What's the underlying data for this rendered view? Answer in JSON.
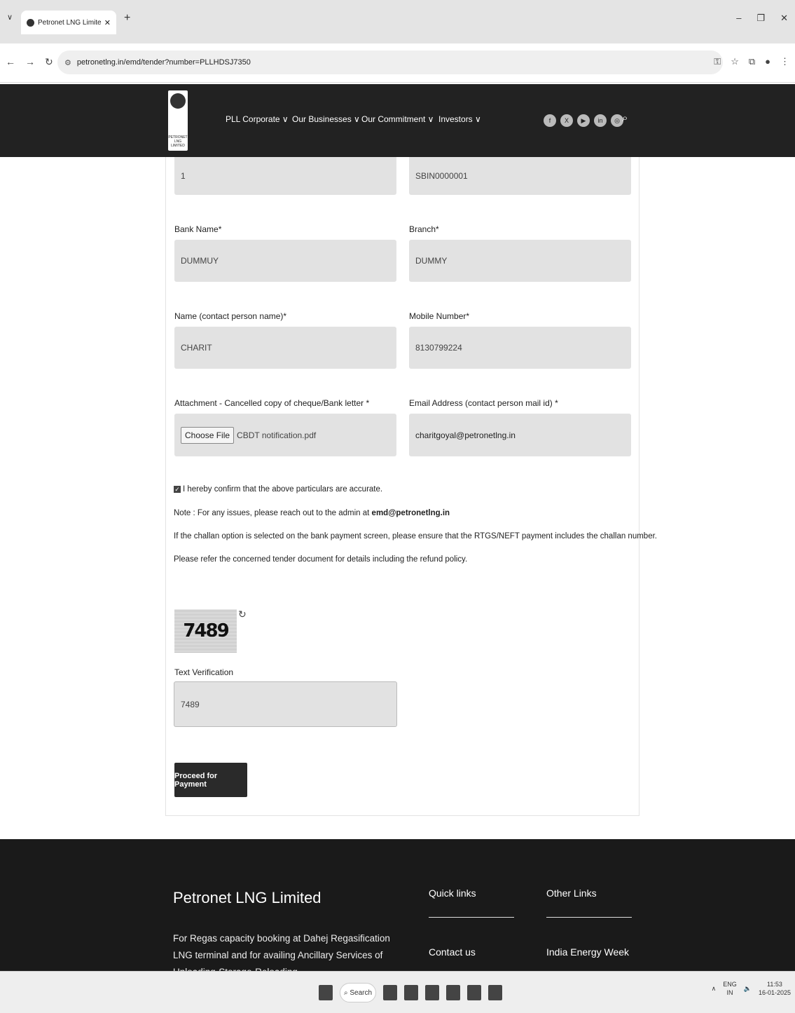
{
  "browser": {
    "tab_title": "Petronet LNG Limited : EMD/Te",
    "url": "petronetlng.in/emd/tender?number=PLLHDSJ7350"
  },
  "header": {
    "menu": [
      "PLL Corporate ∨",
      "Our Businesses ∨",
      "Our Commitment ∨",
      "Investors ∨"
    ],
    "socials": [
      "f",
      "X",
      "▶",
      "in",
      "◎"
    ],
    "logo_text": [
      "PETRONET",
      "LNG",
      "LIMITED"
    ]
  },
  "form": {
    "account_number": "1",
    "ifsc": "SBIN0000001",
    "bank_name_label": "Bank Name*",
    "bank_name": "DUMMUY",
    "branch_label": "Branch*",
    "branch": "DUMMY",
    "contact_label": "Name (contact person name)*",
    "contact": "CHARIT",
    "mobile_label": "Mobile Number*",
    "mobile": "8130799224",
    "attachment_label": "Attachment - Cancelled copy of cheque/Bank letter *",
    "choose_file": "Choose File",
    "file_name": "CBDT notification.pdf",
    "email_label": "Email Address (contact person mail id) *",
    "email": "charitgoyal@petronetlng.in",
    "confirm": "I hereby confirm that the above particulars are accurate.",
    "note_prefix": "Note : For any issues, please reach out to the admin at ",
    "note_email": "emd@petronetlng.in",
    "challan_note": "If the challan option is selected on the bank payment screen, please ensure that the RTGS/NEFT payment includes the challan number.",
    "refund_note": "Please refer the concerned tender document for details including the refund policy.",
    "captcha": "7489",
    "verification_label": "Text Verification",
    "verification_value": "7489",
    "proceed": "Proceed for Payment"
  },
  "footer": {
    "title": "Petronet LNG Limited",
    "desc": "For Regas capacity booking at Dahej Regasification LNG terminal and for availing Ancillary Services of Unloading-Storage-Reloading,",
    "quick_links": "Quick links",
    "other_links": "Other Links",
    "contact": "Contact us",
    "energy": "India Energy Week"
  },
  "taskbar": {
    "search": "Search",
    "lang": "ENG",
    "region": "IN",
    "time": "11:53",
    "date": "16-01-2025"
  }
}
